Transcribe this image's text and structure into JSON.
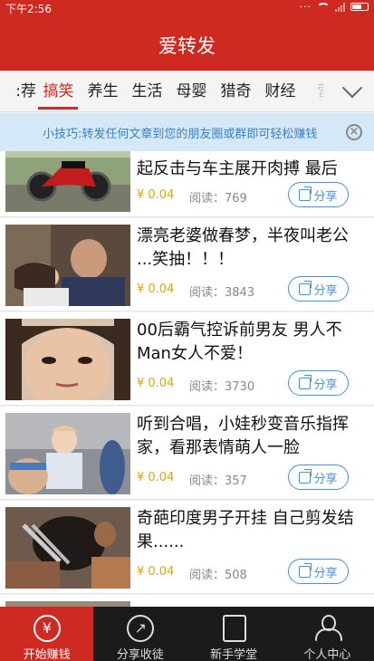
{
  "status_bar": {
    "time": "下午2:56",
    "dots": "··· "
  },
  "header": {
    "title": "爱转发"
  },
  "categories": {
    "items": [
      "荐",
      "搞笑",
      "养生",
      "生活",
      "母婴",
      "猎奇",
      "财经",
      "营"
    ],
    "first_visible_partial": ":荐",
    "active": "搞笑"
  },
  "tip": {
    "text": "小技巧:转发任何文章到您的朋友圈或群即可轻松赚钱"
  },
  "feed": {
    "items": [
      {
        "title": "起反击与车主展开肉搏 最后",
        "price": "¥ 0.04",
        "reads": "阅读：769",
        "share": "分享",
        "thumb": "motorcycle"
      },
      {
        "title": "漂亮老婆做春梦，半夜叫老公 ...笑抽！！！",
        "price": "¥ 0.04",
        "reads": "阅读：3843",
        "share": "分享",
        "thumb": "couple"
      },
      {
        "title": "00后霸气控诉前男友 男人不Man女人不爱！",
        "price": "¥ 0.04",
        "reads": "阅读：3730",
        "share": "分享",
        "thumb": "girl"
      },
      {
        "title": "听到合唱，小娃秒变音乐指挥家，看那表情萌人一脸",
        "price": "¥ 0.04",
        "reads": "阅读：357",
        "share": "分享",
        "thumb": "baby"
      },
      {
        "title": "奇葩印度男子开挂 自己剪发结果......",
        "price": "¥ 0.04",
        "reads": "阅读：508",
        "share": "分享",
        "thumb": "haircut"
      }
    ]
  },
  "tab_bar": {
    "tabs": [
      {
        "label": "开始赚钱",
        "icon": "yen-icon",
        "glyph": "¥"
      },
      {
        "label": "分享收徒",
        "icon": "share-arrow-icon",
        "glyph": "↗"
      },
      {
        "label": "新手学堂",
        "icon": "book-icon",
        "glyph": ""
      },
      {
        "label": "个人中心",
        "icon": "person-icon",
        "glyph": ""
      }
    ]
  },
  "colors": {
    "brand": "#cf2a21",
    "link": "#4a90d9",
    "price": "#e6a400",
    "tip_bg": "#d5e8f7"
  }
}
